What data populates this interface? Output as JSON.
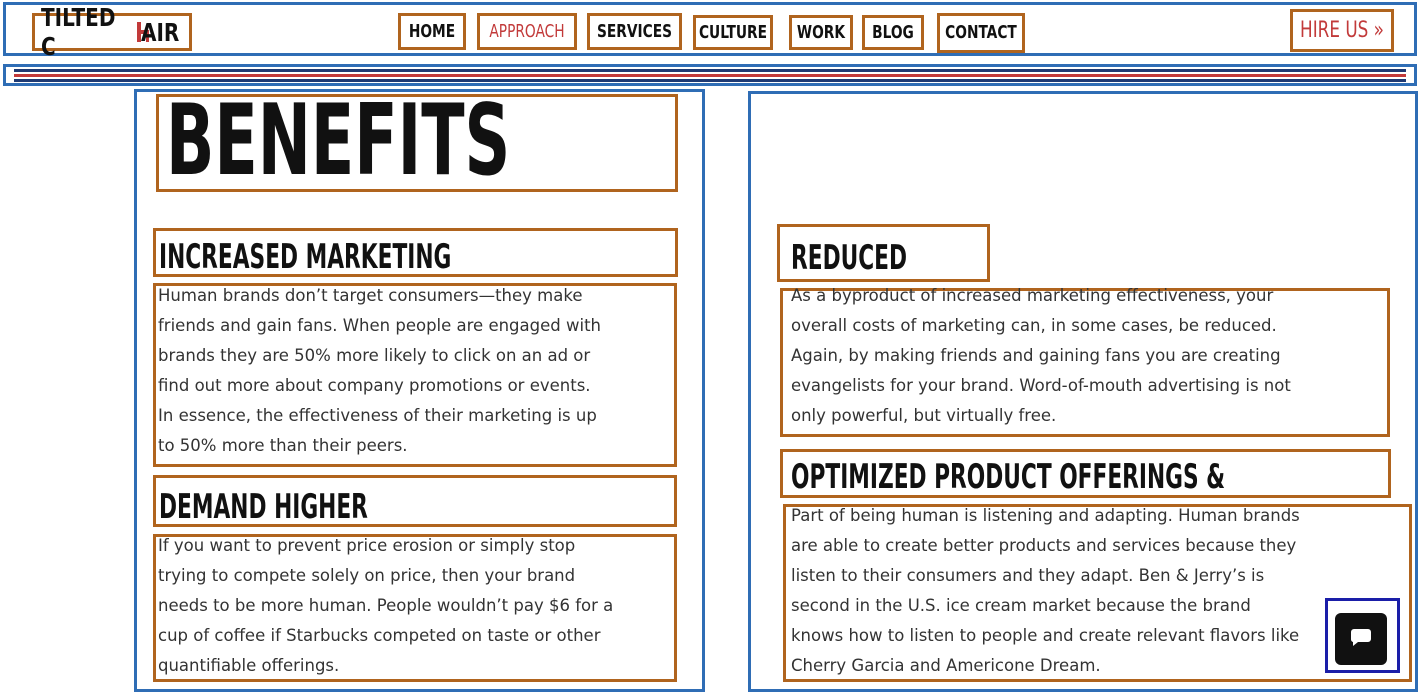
{
  "header": {
    "logo_text_left": "TILTED C",
    "logo_text_right": "AIR",
    "nav": [
      {
        "label": "HOME"
      },
      {
        "label": "APPROACH"
      },
      {
        "label": "SERVICES"
      },
      {
        "label": "CULTURE"
      },
      {
        "label": "WORK"
      },
      {
        "label": "BLOG"
      },
      {
        "label": "CONTACT"
      }
    ],
    "cta_label": "HIRE US »"
  },
  "colors": {
    "brand_red": "#c23a3a",
    "brand_navy": "#1f3a73",
    "text_dark": "#111111"
  },
  "left": {
    "title": "BENEFITS",
    "sections": [
      {
        "heading": "INCREASED MARKETING EFFECTIVENESS",
        "lines": [
          "Human brands don’t target consumers—they make",
          "friends and gain fans. When people are engaged with",
          "brands they are 50% more likely to click on an ad or",
          "find out more about company promotions or events.",
          "In essence, the effectiveness of their marketing is up",
          "to 50% more than their peers."
        ]
      },
      {
        "heading": "DEMAND HIGHER PRICES",
        "lines": [
          "If you want to prevent price erosion or simply stop",
          "trying to compete solely on price, then your brand",
          "needs to be more human. People wouldn’t pay $6 for a",
          "cup of coffee if Starbucks competed on taste or other",
          "quantifiable offerings."
        ]
      }
    ]
  },
  "right": {
    "sections": [
      {
        "heading": "REDUCED COSTS",
        "lines": [
          "As a byproduct of increased marketing effectiveness, your",
          "overall costs of marketing can, in some cases, be reduced.",
          "Again, by making friends and gaining fans you are creating",
          "evangelists for your brand. Word-of-mouth advertising is not",
          "only powerful, but virtually free."
        ]
      },
      {
        "heading": "OPTIMIZED PRODUCT OFFERINGS & SERVICES",
        "lines": [
          "Part of being human is listening and adapting. Human brands",
          "are able to create better products and services because they",
          "listen to their consumers and they adapt. Ben & Jerry’s is",
          "second in the U.S. ice cream market because the brand",
          "knows how to listen to people and create relevant flavors like",
          "Cherry Garcia and Americone Dream."
        ]
      }
    ]
  },
  "chat": {
    "icon": "chat-bubble-icon"
  }
}
